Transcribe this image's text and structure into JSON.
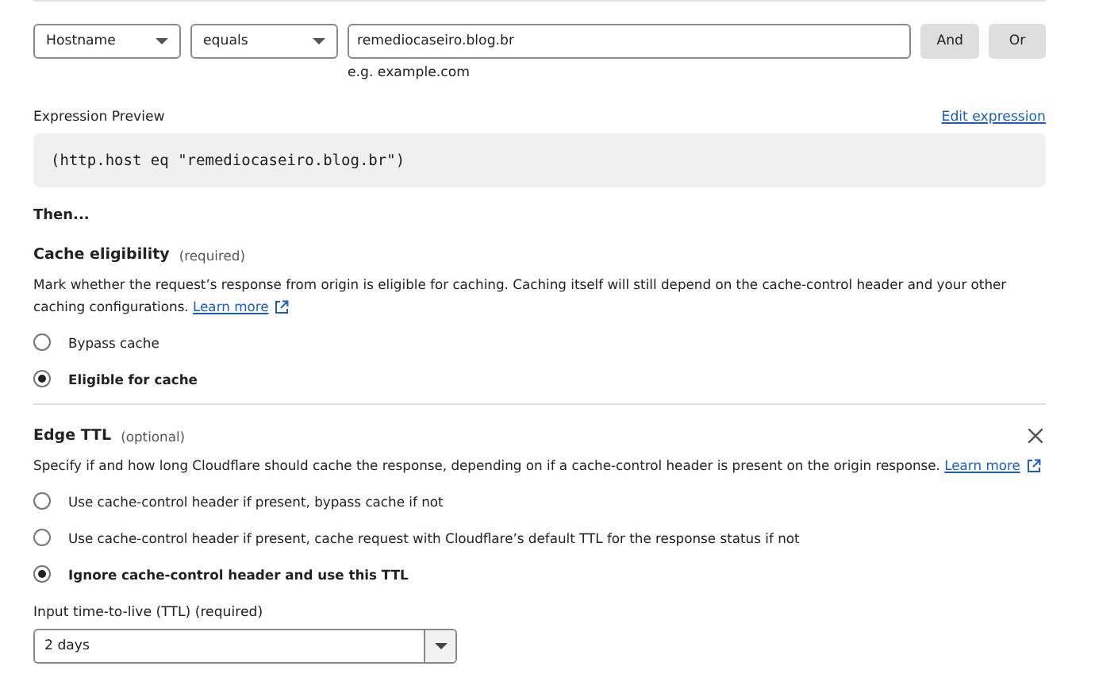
{
  "filter": {
    "field": "Hostname",
    "operator": "equals",
    "value": "remediocaseiro.blog.br",
    "hint": "e.g. example.com",
    "buttons": [
      "And",
      "Or"
    ]
  },
  "expression_preview": {
    "label": "Expression Preview",
    "link": "Edit expression",
    "code": "(http.host eq \"remediocaseiro.blog.br\")"
  },
  "then_heading": "Then...",
  "cache_eligibility": {
    "title": "Cache eligibility",
    "tag": "(required)",
    "description": "Mark whether the request’s response from origin is eligible for caching. Caching itself will still depend on the cache-control header and your other caching configurations.",
    "link": "Learn more",
    "options": [
      {
        "label": "Bypass cache",
        "selected": false
      },
      {
        "label": "Eligible for cache",
        "selected": true
      }
    ]
  },
  "edge_ttl": {
    "title": "Edge TTL",
    "tag": "(optional)",
    "description": "Specify if and how long Cloudflare should cache the response, depending on if a cache-control header is present on the origin response.",
    "link": "Learn more",
    "options": [
      {
        "label": "Use cache-control header if present, bypass cache if not",
        "selected": false
      },
      {
        "label": "Use cache-control header if present, cache request with Cloudflare’s default TTL for the response status if not",
        "selected": false
      },
      {
        "label": "Ignore cache-control header and use this TTL",
        "selected": true
      }
    ],
    "ttl_label": "Input time-to-live (TTL) (required)",
    "ttl_value": "2 days"
  }
}
